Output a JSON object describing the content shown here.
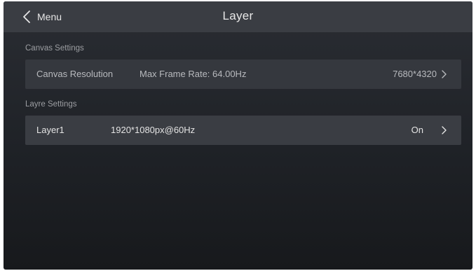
{
  "header": {
    "back_label": "Menu",
    "title": "Layer"
  },
  "canvas_section": {
    "label": "Canvas Settings",
    "row": {
      "label": "Canvas Resolution",
      "detail": "Max Frame Rate: 64.00Hz",
      "value": "7680*4320"
    }
  },
  "layer_section": {
    "label": "Layre Settings",
    "row": {
      "label": "Layer1",
      "detail": "1920*1080px@60Hz",
      "value": "On"
    }
  },
  "icons": {
    "back": "chevron-left-icon",
    "row_arrow": "chevron-right-icon"
  }
}
